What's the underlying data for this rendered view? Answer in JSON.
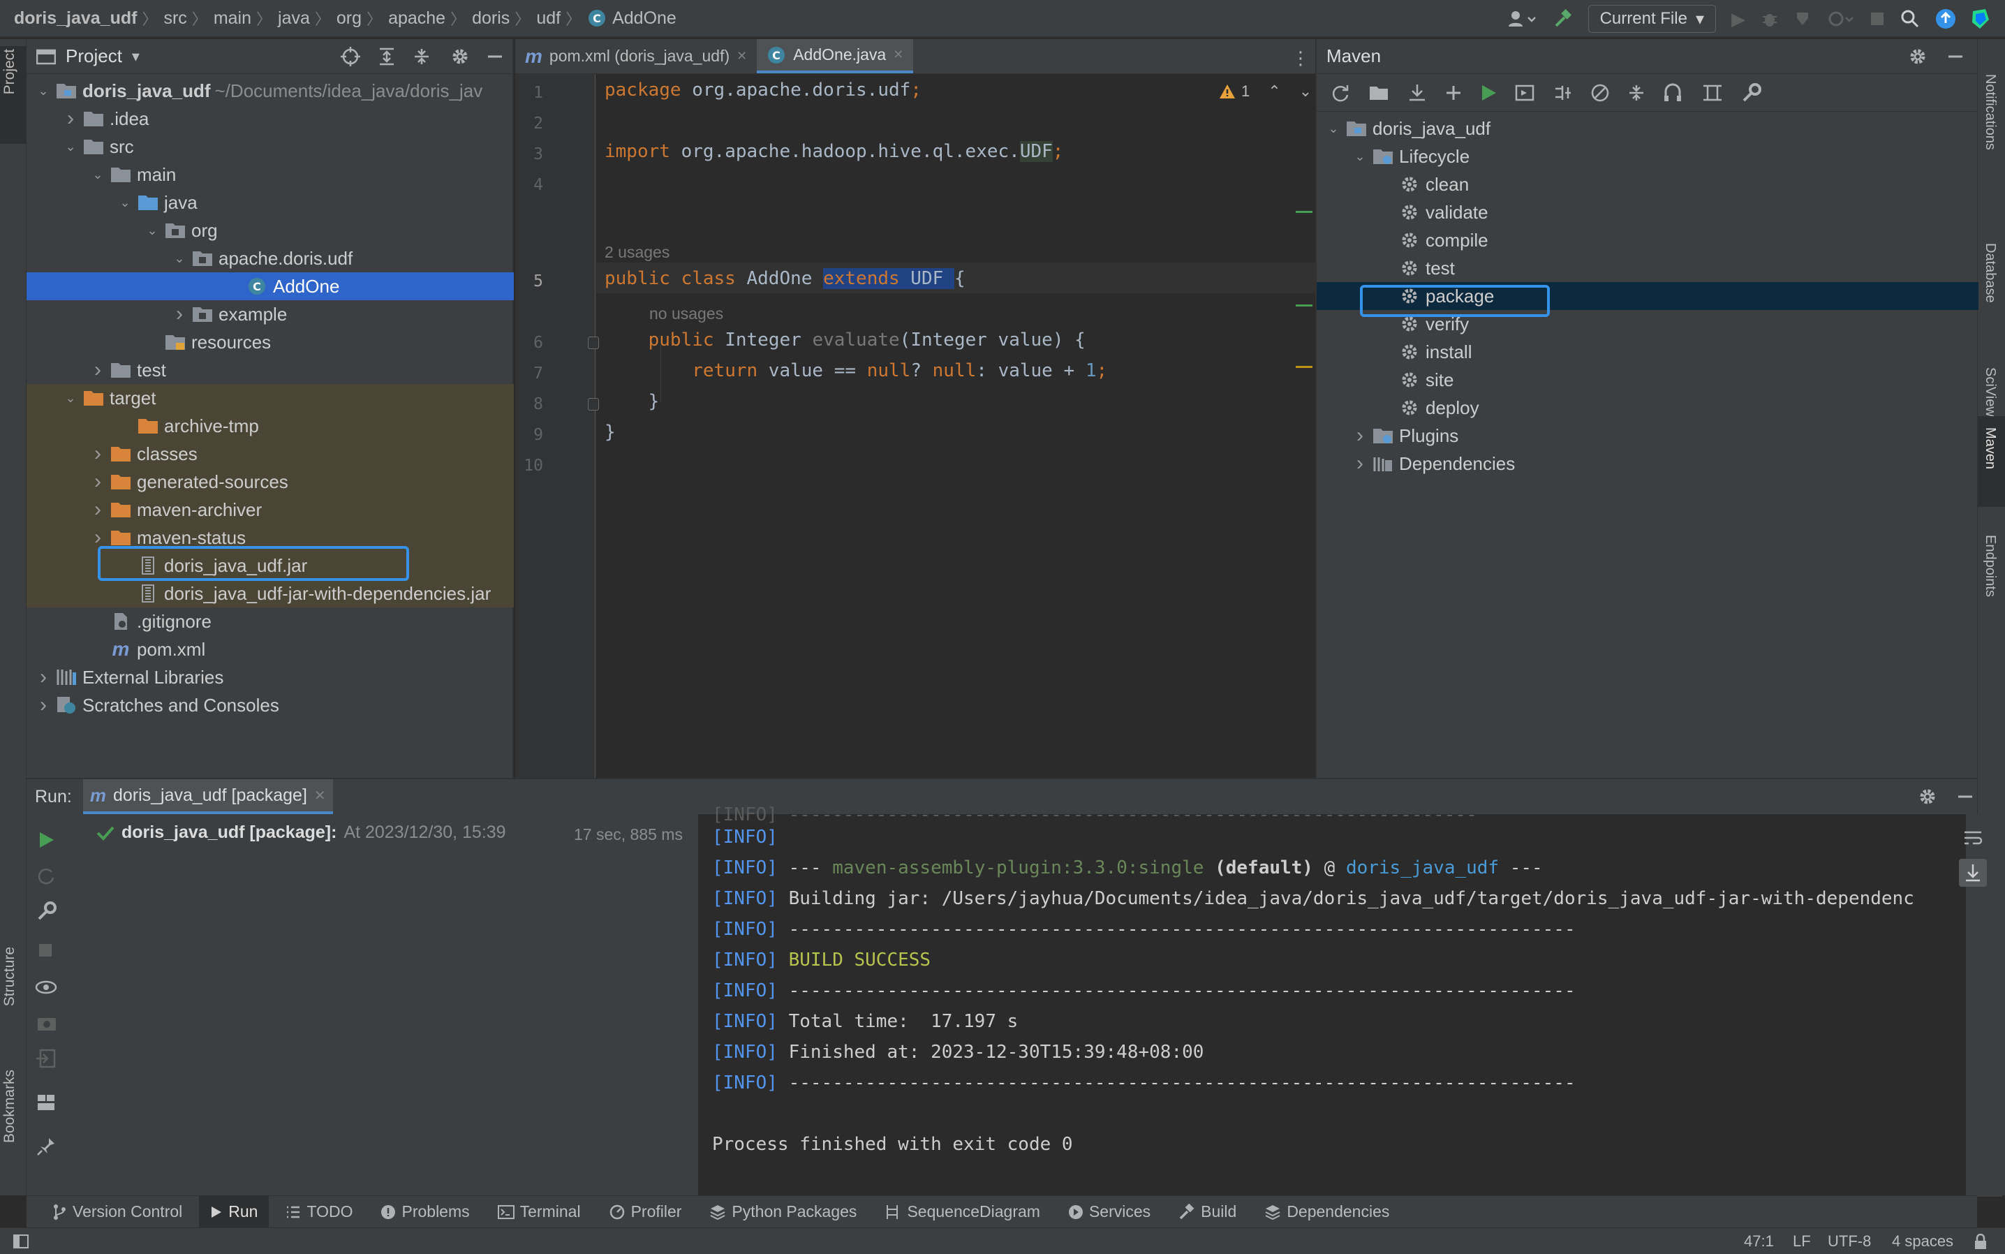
{
  "breadcrumb": [
    "doris_java_udf",
    "src",
    "main",
    "java",
    "org",
    "apache",
    "doris",
    "udf",
    "AddOne"
  ],
  "toolbar": {
    "run_config_label": "Current File"
  },
  "left_stripe": {
    "project_tab": "Project",
    "structure_tab": "Structure",
    "bookmarks_tab": "Bookmarks"
  },
  "right_stripe": {
    "notifications_tab": "Notifications",
    "database_tab": "Database",
    "sciview_tab": "SciView",
    "maven_tab": "Maven",
    "endpoints_tab": "Endpoints"
  },
  "project": {
    "title": "Project",
    "tree": [
      {
        "label": "doris_java_udf",
        "extra": "~/Documents/idea_java/doris_jav",
        "indent": 0,
        "chev": "down",
        "icon": "module"
      },
      {
        "label": ".idea",
        "indent": 1,
        "chev": "right",
        "icon": "folder"
      },
      {
        "label": "src",
        "indent": 1,
        "chev": "down",
        "icon": "folder"
      },
      {
        "label": "main",
        "indent": 2,
        "chev": "down",
        "icon": "folder"
      },
      {
        "label": "java",
        "indent": 3,
        "chev": "down",
        "icon": "folder-blue"
      },
      {
        "label": "org",
        "indent": 4,
        "chev": "down",
        "icon": "package"
      },
      {
        "label": "apache.doris.udf",
        "indent": 5,
        "chev": "down",
        "icon": "package"
      },
      {
        "label": "AddOne",
        "indent": 7,
        "chev": "",
        "icon": "class",
        "selected": true
      },
      {
        "label": "example",
        "indent": 5,
        "chev": "right",
        "icon": "package"
      },
      {
        "label": "resources",
        "indent": 4,
        "chev": "",
        "icon": "folder-res"
      },
      {
        "label": "test",
        "indent": 2,
        "chev": "right",
        "icon": "folder"
      },
      {
        "label": "target",
        "indent": 1,
        "chev": "down",
        "icon": "folder-orange",
        "excluded": true
      },
      {
        "label": "archive-tmp",
        "indent": 3,
        "chev": "",
        "icon": "folder-orange",
        "excluded": true
      },
      {
        "label": "classes",
        "indent": 2,
        "chev": "right",
        "icon": "folder-orange",
        "excluded": true
      },
      {
        "label": "generated-sources",
        "indent": 2,
        "chev": "right",
        "icon": "folder-orange",
        "excluded": true
      },
      {
        "label": "maven-archiver",
        "indent": 2,
        "chev": "right",
        "icon": "folder-orange",
        "excluded": true
      },
      {
        "label": "maven-status",
        "indent": 2,
        "chev": "right",
        "icon": "folder-orange",
        "excluded": true
      },
      {
        "label": "doris_java_udf.jar",
        "indent": 3,
        "chev": "",
        "icon": "jar",
        "excluded": true,
        "highlighted": true
      },
      {
        "label": "doris_java_udf-jar-with-dependencies.jar",
        "indent": 3,
        "chev": "",
        "icon": "jar",
        "excluded": true
      },
      {
        "label": ".gitignore",
        "indent": 2,
        "chev": "",
        "icon": "file"
      },
      {
        "label": "pom.xml",
        "indent": 2,
        "chev": "",
        "icon": "maven"
      },
      {
        "label": "External Libraries",
        "indent": 0,
        "chev": "right",
        "icon": "libs"
      },
      {
        "label": "Scratches and Consoles",
        "indent": 0,
        "chev": "right",
        "icon": "scratch"
      }
    ]
  },
  "editor": {
    "tabs": [
      {
        "label": "pom.xml (doris_java_udf)",
        "icon": "maven",
        "active": false
      },
      {
        "label": "AddOne.java",
        "icon": "class",
        "active": true
      }
    ],
    "warning_count": "1",
    "hint_usages": "2 usages",
    "hint_no_usages": "no usages",
    "line_numbers": [
      "1",
      "2",
      "3",
      "4",
      "5",
      "6",
      "7",
      "8",
      "9",
      "10"
    ]
  },
  "maven": {
    "title": "Maven",
    "project": "doris_java_udf",
    "lifecycle_label": "Lifecycle",
    "goals": [
      "clean",
      "validate",
      "compile",
      "test",
      "package",
      "verify",
      "install",
      "site",
      "deploy"
    ],
    "selected_goal": "package",
    "plugins_label": "Plugins",
    "dependencies_label": "Dependencies"
  },
  "run": {
    "label": "Run:",
    "tab_label": "doris_java_udf [package]",
    "tree_item": "doris_java_udf [package]:",
    "tree_item_time": "At 2023/12/30, 15:39",
    "duration": "17 sec, 885 ms",
    "console": {
      "info": "[INFO]",
      "assembly_prefix": " --- ",
      "assembly_plugin": "maven-assembly-plugin:3.3.0:single",
      "assembly_default": " (default)",
      "assembly_at": " @ ",
      "assembly_project": "doris_java_udf",
      "assembly_suffix": " ---",
      "building_jar": " Building jar: /Users/jayhua/Documents/idea_java/doris_java_udf/target/doris_java_udf-jar-with-dependenc",
      "dashes": " ------------------------------------------------------------------------",
      "build_success": " BUILD SUCCESS",
      "total_time": " Total time:  17.197 s",
      "finished_at": " Finished at: 2023-12-30T15:39:48+08:00",
      "exit": "Process finished with exit code 0"
    }
  },
  "bottom_tabs": [
    "Version Control",
    "Run",
    "TODO",
    "Problems",
    "Terminal",
    "Profiler",
    "Python Packages",
    "SequenceDiagram",
    "Services",
    "Build",
    "Dependencies"
  ],
  "status": {
    "position": "47:1",
    "line_sep": "LF",
    "encoding": "UTF-8",
    "indent": "4 spaces"
  }
}
